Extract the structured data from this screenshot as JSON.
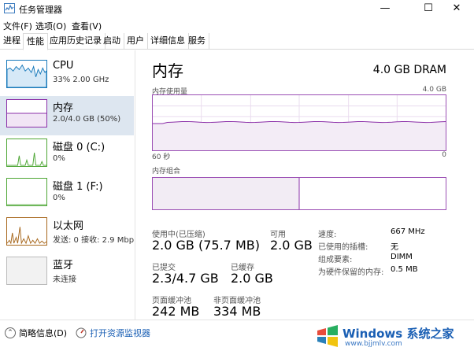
{
  "window": {
    "title": "任务管理器",
    "buttons": {
      "minimize": "—",
      "maximize": "☐",
      "close": "✕"
    }
  },
  "menu": {
    "file": "文件(F)",
    "options": "选项(O)",
    "view": "查看(V)"
  },
  "tabs": [
    "进程",
    "性能",
    "应用历史记录",
    "启动",
    "用户",
    "详细信息",
    "服务"
  ],
  "active_tab": "性能",
  "sidebar": {
    "items": [
      {
        "title": "CPU",
        "sub": "33% 2.00 GHz",
        "color": "#1779ba"
      },
      {
        "title": "内存",
        "sub": "2.0/4.0 GB (50%)",
        "color": "#8b2fa8",
        "usage_fraction": 0.5
      },
      {
        "title": "磁盘 0 (C:)",
        "sub": "0%",
        "color": "#4da634"
      },
      {
        "title": "磁盘 1 (F:)",
        "sub": "0%",
        "color": "#4da634"
      },
      {
        "title": "以太网",
        "sub": "发送: 0 接收: 2.9 Mbp",
        "color": "#a7671c"
      },
      {
        "title": "蓝牙",
        "sub": "未连接",
        "color": "#999999"
      }
    ]
  },
  "main": {
    "title": "内存",
    "capacity": "4.0 GB DRAM",
    "usage_label": "内存使用量",
    "usage_max": "4.0 GB",
    "axis_left": "60 秒",
    "axis_right": "0",
    "composition_label": "内存组合",
    "composition_in_use_fraction": 0.5
  },
  "stats": {
    "in_use_label": "使用中(已压缩)",
    "in_use_value": "2.0 GB (75.7 MB)",
    "available_label": "可用",
    "available_value": "2.0 GB",
    "committed_label": "已提交",
    "committed_value": "2.3/4.7 GB",
    "cached_label": "已缓存",
    "cached_value": "2.0 GB",
    "paged_label": "页面缓冲池",
    "paged_value": "242 MB",
    "nonpaged_label": "非页面缓冲池",
    "nonpaged_value": "334 MB"
  },
  "details": {
    "speed_label": "速度:",
    "speed_value": "667 MHz",
    "slots_label": "已使用的插槽:",
    "slots_value": "无",
    "form_label": "组成要素:",
    "form_value": "DIMM",
    "reserved_label": "为硬件保留的内存:",
    "reserved_value": "0.5 MB"
  },
  "footer": {
    "brief_label": "简略信息(D)",
    "resource_monitor_label": "打开资源监视器"
  },
  "brand": {
    "name": "Windows",
    "suffix": "系统之家",
    "url": "www.bjjmlv.com"
  },
  "colors": {
    "memory": "#8b2fa8",
    "active_bg": "#dde6f0"
  }
}
